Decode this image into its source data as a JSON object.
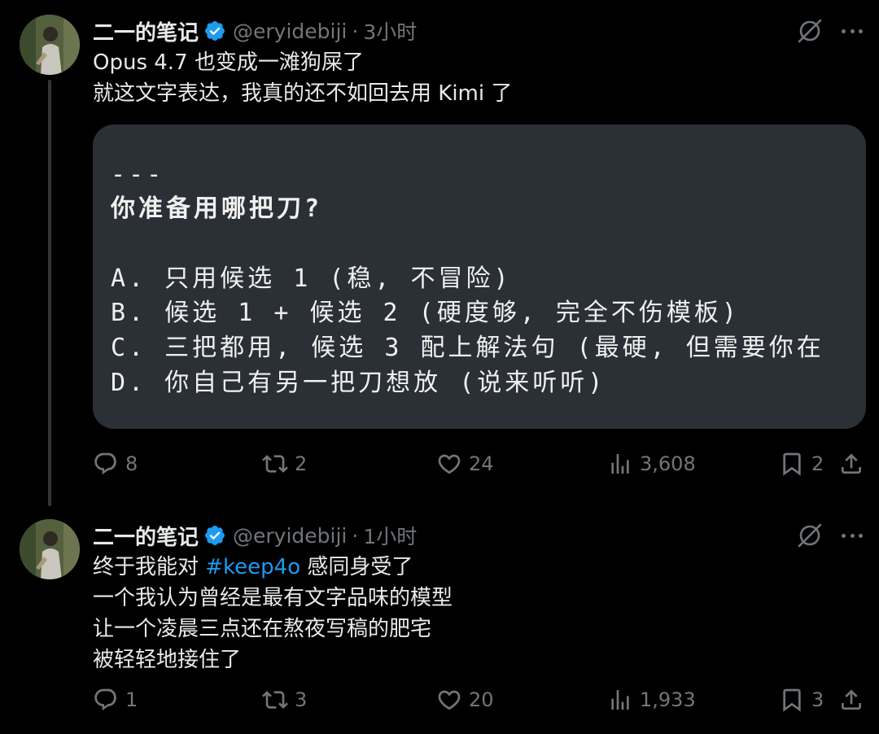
{
  "tweets": [
    {
      "author": {
        "display_name": "二一的笔记",
        "handle": "@eryidebiji",
        "verified": true
      },
      "time": "3小时",
      "text_lines": [
        "Opus 4.7 也变成一滩狗屎了",
        "就这文字表达，我真的还不如回去用 Kimi 了"
      ],
      "media": {
        "lines": [
          "---",
          "你准备用哪把刀?",
          "A. 只用候选 1 (稳, 不冒险)",
          "B. 候选 1 + 候选 2 (硬度够, 完全不伤模板)",
          "C. 三把都用, 候选 3 配上解法句 (最硬, 但需要你在",
          "D. 你自己有另一把刀想放 (说来听听)"
        ]
      },
      "stats": {
        "replies": "8",
        "reposts": "2",
        "likes": "24",
        "views": "3,608",
        "bookmarks": "2"
      }
    },
    {
      "author": {
        "display_name": "二一的笔记",
        "handle": "@eryidebiji",
        "verified": true
      },
      "time": "1小时",
      "text_lines": [
        {
          "prefix": "终于我能对 ",
          "hashtag": "#keep4o",
          "suffix": " 感同身受了"
        },
        "一个我认为曾经是最有文字品味的模型",
        "让一个凌晨三点还在熬夜写稿的肥宅",
        "被轻轻地接住了"
      ],
      "stats": {
        "replies": "1",
        "reposts": "3",
        "likes": "20",
        "views": "1,933",
        "bookmarks": "3"
      }
    }
  ],
  "theme": {
    "background": "#000000",
    "text": "#e7e9ea",
    "muted": "#71767b",
    "accent": "#1d9bf0",
    "code_bg": "#2b2f36"
  },
  "icons": [
    "verified-badge-icon",
    "grok-icon",
    "more-icon",
    "reply-icon",
    "repost-icon",
    "like-icon",
    "views-icon",
    "bookmark-icon",
    "share-icon"
  ]
}
